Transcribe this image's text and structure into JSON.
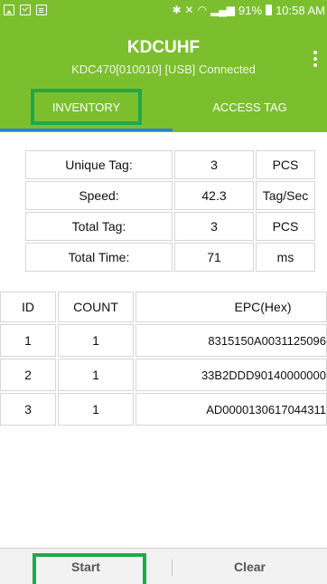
{
  "status_bar": {
    "battery_percent": "91%",
    "time": "10:58 AM"
  },
  "app_bar": {
    "title": "KDCUHF",
    "subtitle": "KDC470[010010] [USB] Connected"
  },
  "tabs": [
    {
      "label": "INVENTORY",
      "selected": true
    },
    {
      "label": "ACCESS TAG",
      "selected": false
    }
  ],
  "stats": [
    {
      "label": "Unique Tag:",
      "value": "3",
      "unit": "PCS"
    },
    {
      "label": "Speed:",
      "value": "42.3",
      "unit": "Tag/Sec"
    },
    {
      "label": "Total Tag:",
      "value": "3",
      "unit": "PCS"
    },
    {
      "label": "Total Time:",
      "value": "71",
      "unit": "ms"
    }
  ],
  "tag_table": {
    "headers": [
      "ID",
      "COUNT",
      "EPC(Hex)"
    ],
    "rows": [
      {
        "id": "1",
        "count": "1",
        "epc": "8315150A0031125096"
      },
      {
        "id": "2",
        "count": "1",
        "epc": "33B2DDD90140000000"
      },
      {
        "id": "3",
        "count": "1",
        "epc": "AD0000130617044311"
      }
    ]
  },
  "buttons": {
    "start": "Start",
    "clear": "Clear"
  },
  "colors": {
    "app_bar": "#7bbf2f",
    "tab_indicator": "#2b7fd0",
    "highlight_box": "#22a848"
  }
}
